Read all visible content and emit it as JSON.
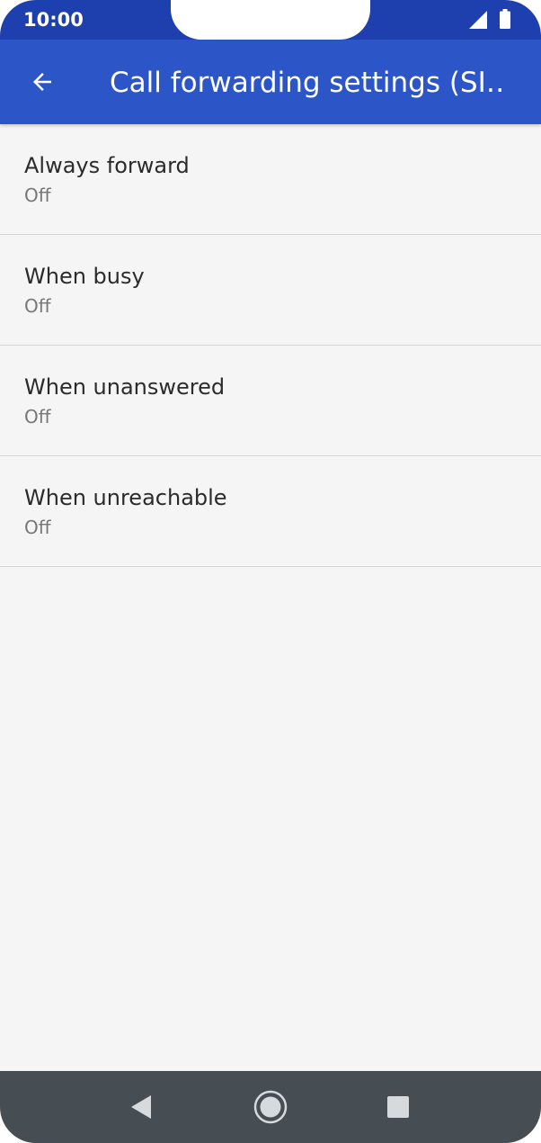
{
  "status_bar": {
    "time": "10:00",
    "icons": [
      "signal-icon",
      "battery-icon"
    ]
  },
  "app_bar": {
    "title": "Call forwarding settings (SI…",
    "back_icon": "arrow-left-icon",
    "color": "#2c55c8",
    "status_color": "#1e3fae"
  },
  "list": {
    "items": [
      {
        "title": "Always forward",
        "summary": "Off"
      },
      {
        "title": "When busy",
        "summary": "Off"
      },
      {
        "title": "When unanswered",
        "summary": "Off"
      },
      {
        "title": "When unreachable",
        "summary": "Off"
      }
    ]
  },
  "nav_bar": {
    "icons": [
      "back-triangle-icon",
      "home-circle-icon",
      "recents-square-icon"
    ],
    "color": "#464e53"
  }
}
